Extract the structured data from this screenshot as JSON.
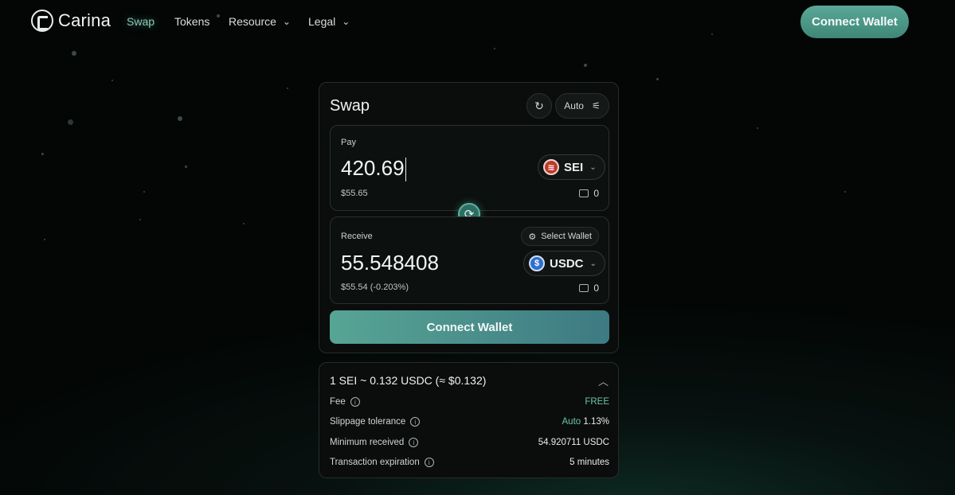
{
  "nav": {
    "brand": "Carina",
    "links": [
      {
        "label": "Swap",
        "active": true
      },
      {
        "label": "Tokens"
      },
      {
        "label": "Resource",
        "dropdown": true
      },
      {
        "label": "Legal",
        "dropdown": true
      }
    ],
    "connect_label": "Connect Wallet"
  },
  "swap": {
    "title": "Swap",
    "refresh_icon": "refresh-icon",
    "auto_label": "Auto",
    "settings_icon": "sliders-icon",
    "pay": {
      "label": "Pay",
      "amount": "420.69",
      "usd": "$55.65",
      "token": "SEI",
      "token_icon": "sei-icon",
      "balance": "0"
    },
    "receive": {
      "label": "Receive",
      "amount": "55.548408",
      "usd": "$55.54 (-0.203%)",
      "token": "USDC",
      "token_icon": "usdc-icon",
      "balance": "0",
      "select_wallet_label": "Select Wallet"
    },
    "connect_label": "Connect Wallet"
  },
  "details": {
    "rate": "1 SEI ~ 0.132 USDC (≈ $0.132)",
    "rows": [
      {
        "label": "Fee",
        "value": "FREE"
      },
      {
        "label": "Slippage tolerance",
        "prefix": "Auto",
        "value": "1.13%"
      },
      {
        "label": "Minimum received",
        "value": "54.920711 USDC"
      },
      {
        "label": "Transaction expiration",
        "value": "5 minutes"
      }
    ]
  },
  "colors": {
    "accent": "#5aa898",
    "accent_text": "#6fc3ab",
    "background": "#030605",
    "card": "#0a0d0c"
  }
}
